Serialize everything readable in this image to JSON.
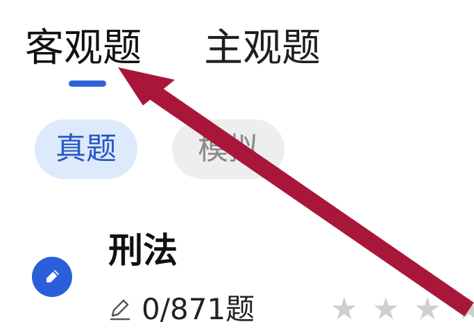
{
  "tabs": [
    {
      "label": "客观题",
      "active": true
    },
    {
      "label": "主观题",
      "active": false
    }
  ],
  "filters": [
    {
      "label": "真题",
      "active": true
    },
    {
      "label": "模拟",
      "active": false
    }
  ],
  "subject": {
    "icon": "pencil-circle-icon",
    "title": "刑法",
    "progress_icon": "pencil-icon",
    "progress": "0/871题",
    "rating": 0
  },
  "colors": {
    "accent": "#2f63d8",
    "active_chip_bg": "#dceafb",
    "inactive_chip_bg": "#eeeeee",
    "annotation_arrow": "#a8173a",
    "star_empty": "#cfcfcf"
  }
}
